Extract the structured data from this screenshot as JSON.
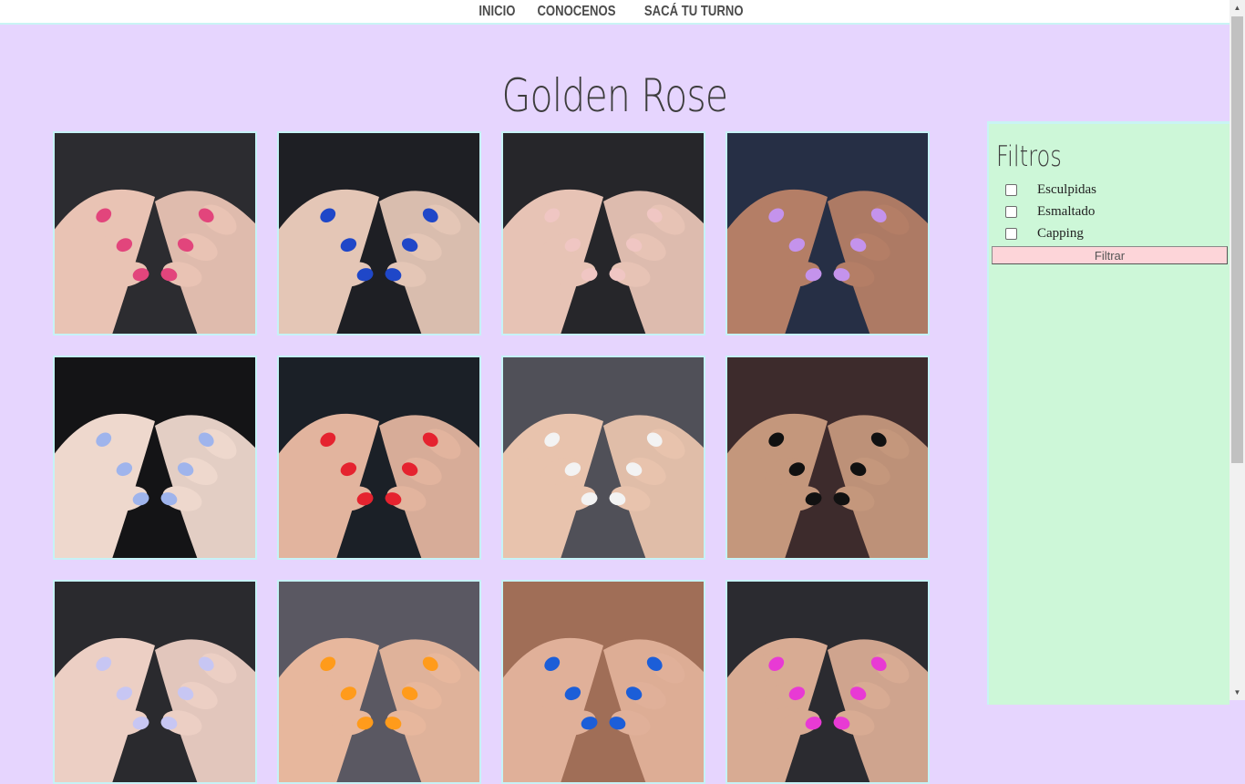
{
  "nav": {
    "links": [
      "INICIO",
      "CONOCENOS",
      "SACÁ TU TURNO"
    ]
  },
  "page": {
    "title": "Golden Rose"
  },
  "gallery": {
    "photos": [
      {
        "name": "photo-pink-swirl-nails",
        "colors": [
          "#2c2c30",
          "#e9c3b4",
          "#e2457c"
        ]
      },
      {
        "name": "photo-blue-nails",
        "colors": [
          "#1e1f24",
          "#e4c6b6",
          "#1f47c8"
        ]
      },
      {
        "name": "photo-nude-black-tip-nails",
        "colors": [
          "#26262a",
          "#e7c3b5",
          "#f0c6c3"
        ]
      },
      {
        "name": "photo-lilac-feather-nails",
        "colors": [
          "#262f45",
          "#b47e66",
          "#c493ec"
        ]
      },
      {
        "name": "photo-light-blue-nails",
        "colors": [
          "#141416",
          "#eed8cd",
          "#9fb4ec"
        ]
      },
      {
        "name": "photo-red-nails",
        "colors": [
          "#1b2027",
          "#e2b49e",
          "#e5232f"
        ]
      },
      {
        "name": "photo-black-white-moon-nails",
        "colors": [
          "#505058",
          "#e8c3ad",
          "#f3f3f3"
        ]
      },
      {
        "name": "photo-black-lines-nails",
        "colors": [
          "#3d2b2c",
          "#c4977c",
          "#111111"
        ]
      },
      {
        "name": "photo-lavender-nails",
        "colors": [
          "#2a2a2e",
          "#eccfc4",
          "#c7c6f3"
        ]
      },
      {
        "name": "photo-orange-nails",
        "colors": [
          "#5a5862",
          "#e7b79d",
          "#ff9b1b"
        ]
      },
      {
        "name": "photo-royal-blue-nails",
        "colors": [
          "#a06e57",
          "#e0b099",
          "#1c5ed8"
        ]
      },
      {
        "name": "photo-magenta-nails",
        "colors": [
          "#2b2b30",
          "#d8ab93",
          "#e83ad4"
        ]
      }
    ]
  },
  "sidebar": {
    "heading": "Filtros",
    "filters": [
      "Esculpidas",
      "Esmaltado",
      "Capping"
    ],
    "button_label": "Filtrar"
  },
  "colors": {
    "page_bg": "#e6d5fe",
    "sidebar_bg": "#cdf7d8",
    "tile_border": "#c6f2f6",
    "button_bg": "#fdd5d9"
  }
}
